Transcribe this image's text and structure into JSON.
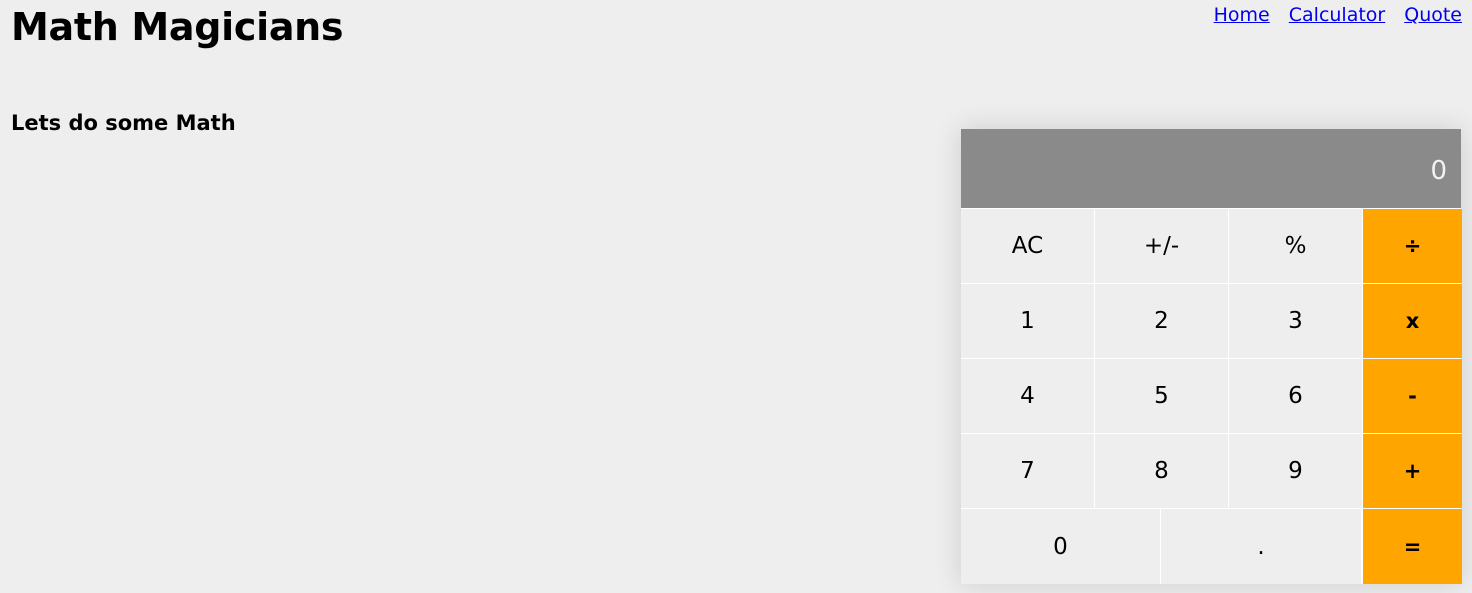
{
  "header": {
    "title": "Math Magicians",
    "nav": [
      "Home",
      "Calculator",
      "Quote"
    ]
  },
  "intro": "Lets do some Math",
  "calculator": {
    "display": "0",
    "rows": [
      [
        "AC",
        "+/-",
        "%",
        "÷"
      ],
      [
        "1",
        "2",
        "3",
        "x"
      ],
      [
        "4",
        "5",
        "6",
        "-"
      ],
      [
        "7",
        "8",
        "9",
        "+"
      ]
    ],
    "bottom": [
      "0",
      ".",
      "="
    ]
  },
  "colors": {
    "background": "#eeeeee",
    "display": "#8a8a8a",
    "operator": "#ffa500",
    "link": "#0000ee"
  }
}
